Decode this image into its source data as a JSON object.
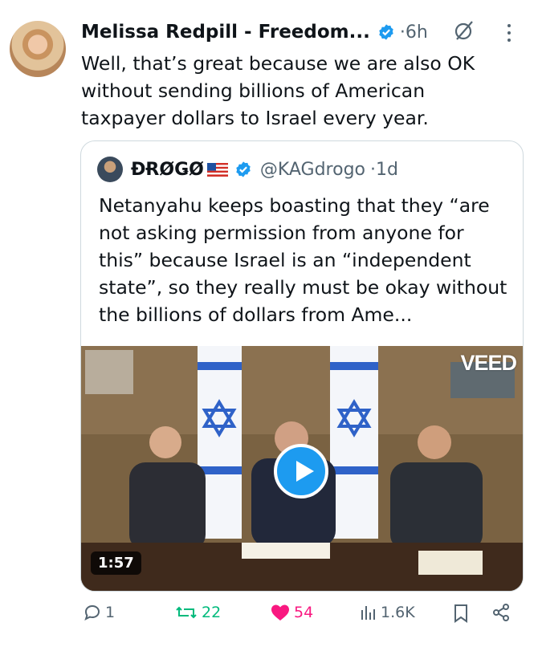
{
  "post": {
    "author_name": "Melissa Redpill - Freedom...",
    "time": "6h",
    "separator": "·",
    "text": "Well, that’s great because we are also OK without sending billions of American taxpayer dollars to Israel every year."
  },
  "quote": {
    "author_name": "ĐɌØǤØ",
    "handle": "@KAGdrogo",
    "separator": "·",
    "time": "1d",
    "text": "Netanyahu keeps boasting that they “are not asking permission from anyone for this” because Israel is an “independent state”, so they really must be okay without the billions of dollars from Ame...",
    "video": {
      "watermark": "VEED",
      "duration": "1:57"
    }
  },
  "actions": {
    "replies": "1",
    "reposts": "22",
    "likes": "54",
    "views": "1.6K"
  },
  "colors": {
    "verified": "#1d9bf0",
    "repost": "#00ba7c",
    "like": "#f91880",
    "muted": "#536471"
  },
  "icons": [
    "verified-badge-icon",
    "grok-icon",
    "more-icon",
    "flag-us-icon",
    "play-icon",
    "reply-icon",
    "repost-icon",
    "like-icon",
    "views-icon",
    "bookmark-icon",
    "share-icon"
  ]
}
